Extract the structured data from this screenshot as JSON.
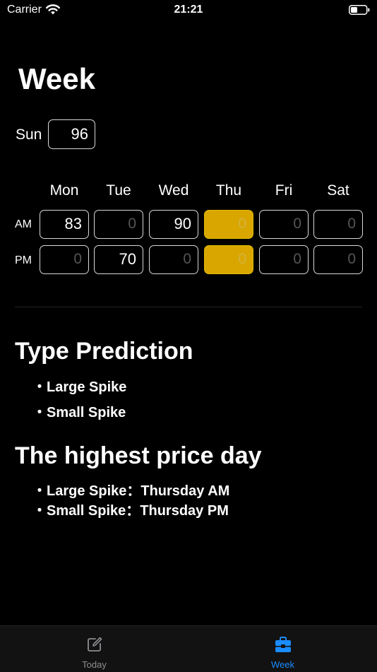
{
  "status_bar": {
    "carrier": "Carrier",
    "time": "21:21"
  },
  "page": {
    "title": "Week"
  },
  "sunday": {
    "label": "Sun",
    "value": "96"
  },
  "week_table": {
    "days": [
      "Mon",
      "Tue",
      "Wed",
      "Thu",
      "Fri",
      "Sat"
    ],
    "rows": [
      {
        "label": "AM",
        "values": [
          "83",
          "0",
          "90",
          "0",
          "0",
          "0"
        ]
      },
      {
        "label": "PM",
        "values": [
          "0",
          "70",
          "0",
          "0",
          "0",
          "0"
        ]
      }
    ],
    "highlight_day": "Thu",
    "highlight_color": "#d9a600"
  },
  "type_prediction": {
    "title": "Type Prediction",
    "items": [
      "・Large Spike",
      "・Small Spike"
    ]
  },
  "highest_price": {
    "title": "The highest price day",
    "items": [
      "・Large Spike：Thursday AM",
      "・Small Spike：Thursday PM"
    ]
  },
  "tab_bar": {
    "tabs": [
      {
        "label": "Today",
        "icon": "edit-icon",
        "active": false
      },
      {
        "label": "Week",
        "icon": "toolbox-icon",
        "active": true
      }
    ],
    "active_color": "#1a8cff",
    "inactive_color": "#8e8e93"
  }
}
